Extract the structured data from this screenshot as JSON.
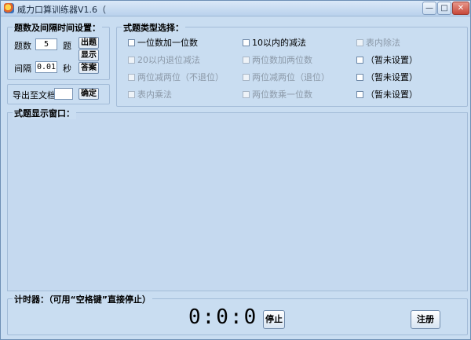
{
  "window": {
    "title": "威力口算训练器V1.6（",
    "min_label": "—",
    "max_label": "□",
    "close_label": "✕"
  },
  "settings": {
    "title": "题数及间隔时间设置：",
    "count_label": "题数",
    "count_value": "5",
    "count_unit": "题",
    "interval_label": "间隔",
    "interval_value": "0.01",
    "interval_unit": "秒",
    "btn_generate": "出题",
    "btn_show": "显示",
    "btn_answer": "答案"
  },
  "export": {
    "label": "导出至文档",
    "value": "",
    "btn_confirm": "确定"
  },
  "types": {
    "title": "式题类型选择：",
    "items": [
      {
        "label": "一位数加一位数",
        "enabled": true
      },
      {
        "label": "10以内的减法",
        "enabled": true
      },
      {
        "label": "表内除法",
        "enabled": false
      },
      {
        "label": "20以内退位减法",
        "enabled": false
      },
      {
        "label": "两位数加两位数",
        "enabled": false
      },
      {
        "label": "（暂未设置）",
        "enabled": true
      },
      {
        "label": "两位减两位（不退位）",
        "enabled": false
      },
      {
        "label": "两位减两位（退位）",
        "enabled": false
      },
      {
        "label": "（暂未设置）",
        "enabled": true
      },
      {
        "label": "表内乘法",
        "enabled": false
      },
      {
        "label": "两位数乘一位数",
        "enabled": false
      },
      {
        "label": "（暂未设置）",
        "enabled": true
      }
    ]
  },
  "display": {
    "title": "式题显示窗口："
  },
  "timer": {
    "title": "计时器：（可用“空格键”直接停止）",
    "value": "0:0:0",
    "btn_stop": "停止",
    "btn_register": "注册"
  }
}
